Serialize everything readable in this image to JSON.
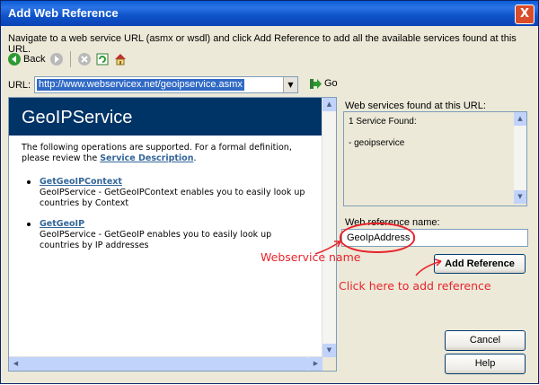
{
  "window": {
    "title": "Add Web Reference"
  },
  "instructions": "Navigate to a web service URL (asmx or wsdl) and click Add Reference to add all the available services found at this URL.",
  "toolbar": {
    "back_label": "Back"
  },
  "url": {
    "label": "URL:",
    "value": "http://www.webservicex.net/geoipservice.asmx",
    "go_label": "Go"
  },
  "browser": {
    "banner_title": "GeoIPService",
    "intro_prefix": "The following operations are supported. For a formal definition, please review the",
    "intro_link": "Service Description",
    "intro_suffix": ".",
    "operations": [
      {
        "name": "GetGeoIPContext",
        "description": "GeoIPService - GetGeoIPContext enables you to easily look up countries by Context"
      },
      {
        "name": "GetGeoIP",
        "description": "GeoIPService - GetGeoIP enables you to easily look up countries by IP addresses"
      }
    ]
  },
  "services_panel": {
    "label": "Web services found at this URL:",
    "found_text": "1 Service Found:",
    "item": "- geoipservice"
  },
  "reference": {
    "label": "Web reference name:",
    "value": "GeoIpAddress"
  },
  "buttons": {
    "add_reference": "Add Reference",
    "cancel": "Cancel",
    "help": "Help",
    "close": "X"
  },
  "annotations": {
    "webservice_name": "Webservice name",
    "click_here": "Click here to add reference"
  },
  "colors": {
    "title_bar": "#0a5bd6",
    "banner": "#003366",
    "annotation": "#e8242c",
    "link": "#336699"
  }
}
